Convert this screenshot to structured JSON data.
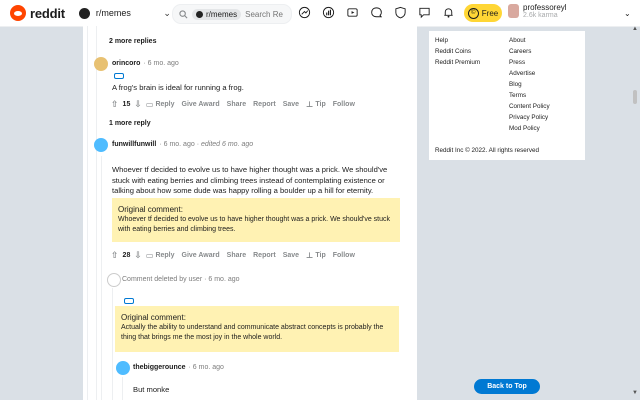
{
  "topbar": {
    "logo_text": "reddit",
    "community": "r/memes",
    "search_chip": "r/memes",
    "search_placeholder": "Search Re",
    "free_label": "Free",
    "username": "professoreyl",
    "karma": "2.6k karma"
  },
  "thread": {
    "more_replies_1": "2 more replies",
    "more_replies_2": "1 more reply",
    "comments": [
      {
        "author": "orincoro",
        "time": "6 mo. ago",
        "body": "A frog's brain is ideal for running a frog.",
        "votes": "15"
      },
      {
        "author": "funwillfunwill",
        "time": "6 mo. ago",
        "edited": "edited 6 mo. ago",
        "body": "Whoever tf decided to evolve us to have higher thought was a prick. We should've stuck with eating berries and climbing trees instead of contemplating existence or talking about how some dude was happy rolling a boulder up a hill for eternity.",
        "votes": "28",
        "quote_title": "Original comment:",
        "quote_text": "Whoever tf decided to evolve us to have higher thought was a prick. We should've stuck with eating berries and climbing trees."
      },
      {
        "deleted_text": "Comment deleted by user",
        "time": "6 mo. ago",
        "quote_title": "Original comment:",
        "quote_text": "Actually the ability to understand and communicate abstract concepts is probably the thing that brings me the most joy in the whole world."
      },
      {
        "author": "thebiggerounce",
        "time": "6 mo. ago",
        "body": "But monke"
      }
    ],
    "actions": {
      "reply": "Reply",
      "give_award": "Give Award",
      "share": "Share",
      "report": "Report",
      "save": "Save",
      "tip": "Tip",
      "follow": "Follow"
    }
  },
  "sidebar": {
    "col1": [
      "Help",
      "Reddit Coins",
      "Reddit Premium"
    ],
    "col2": [
      "About",
      "Careers",
      "Press",
      "Advertise",
      "Blog",
      "Terms",
      "Content Policy",
      "Privacy Policy",
      "Mod Policy"
    ],
    "copyright": "Reddit Inc © 2022. All rights reserved"
  },
  "back_to_top": "Back to Top",
  "colors": {
    "accent": "#0079d3",
    "brand": "#ff4500",
    "quote_bg": "#fff2b3",
    "page_bg": "#dae0e6"
  }
}
